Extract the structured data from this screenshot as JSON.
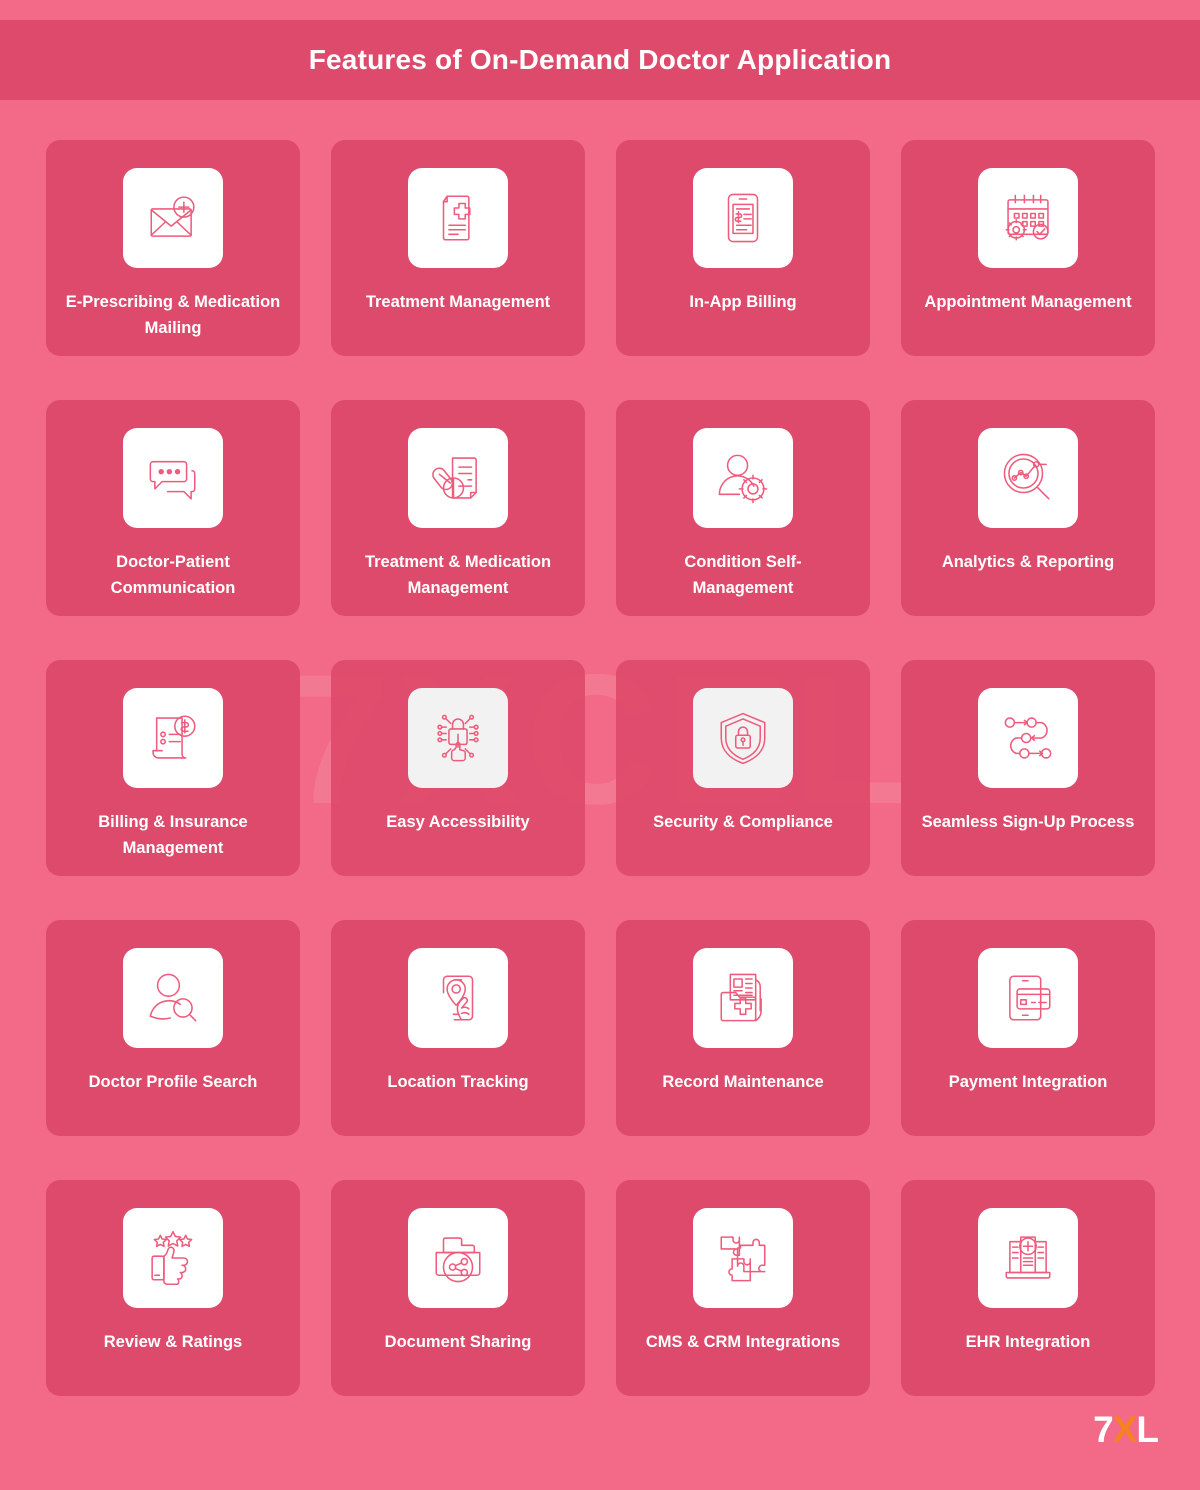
{
  "header": {
    "title": "Features of On-Demand Doctor Application"
  },
  "watermark": {
    "text": "7XCEL"
  },
  "logo": {
    "part1": "7",
    "part2": "X",
    "part3": "L",
    "accent_color": "#F58220"
  },
  "theme": {
    "page_background": "#F26A87",
    "card_background": "#DE4A6B",
    "header_background": "#DE4A6B",
    "icon_tile_background": "#FFFFFF",
    "icon_stroke": "#EE5C7D",
    "label_color": "#FFFFFF"
  },
  "features": [
    {
      "label": "E-Prescribing & Medication Mailing",
      "icon": "envelope-medical-icon"
    },
    {
      "label": "Treatment Management",
      "icon": "medical-document-icon"
    },
    {
      "label": "In-App Billing",
      "icon": "phone-invoice-icon"
    },
    {
      "label": "Appointment Management",
      "icon": "calendar-gear-check-icon"
    },
    {
      "label": "Doctor-Patient Communication",
      "icon": "chat-bubbles-icon"
    },
    {
      "label": "Treatment & Medication Management",
      "icon": "prescription-pills-icon"
    },
    {
      "label": "Condition Self-Management",
      "icon": "person-gear-icon"
    },
    {
      "label": "Analytics & Reporting",
      "icon": "magnifier-chart-icon"
    },
    {
      "label": "Billing & Insurance Management",
      "icon": "invoice-dollar-icon"
    },
    {
      "label": "Easy Accessibility",
      "icon": "lock-circuit-touch-icon"
    },
    {
      "label": "Security & Compliance",
      "icon": "shield-lock-icon"
    },
    {
      "label": "Seamless Sign-Up Process",
      "icon": "process-flow-icon"
    },
    {
      "label": "Doctor Profile Search",
      "icon": "person-search-icon"
    },
    {
      "label": "Location Tracking",
      "icon": "phone-location-pin-icon"
    },
    {
      "label": "Record Maintenance",
      "icon": "medical-folder-record-icon"
    },
    {
      "label": "Payment Integration",
      "icon": "phone-credit-card-icon"
    },
    {
      "label": "Review & Ratings",
      "icon": "thumbs-up-stars-icon"
    },
    {
      "label": "Document Sharing",
      "icon": "folder-share-icon"
    },
    {
      "label": "CMS & CRM Integrations",
      "icon": "puzzle-pieces-icon"
    },
    {
      "label": "EHR Integration",
      "icon": "hospital-record-icon"
    }
  ]
}
